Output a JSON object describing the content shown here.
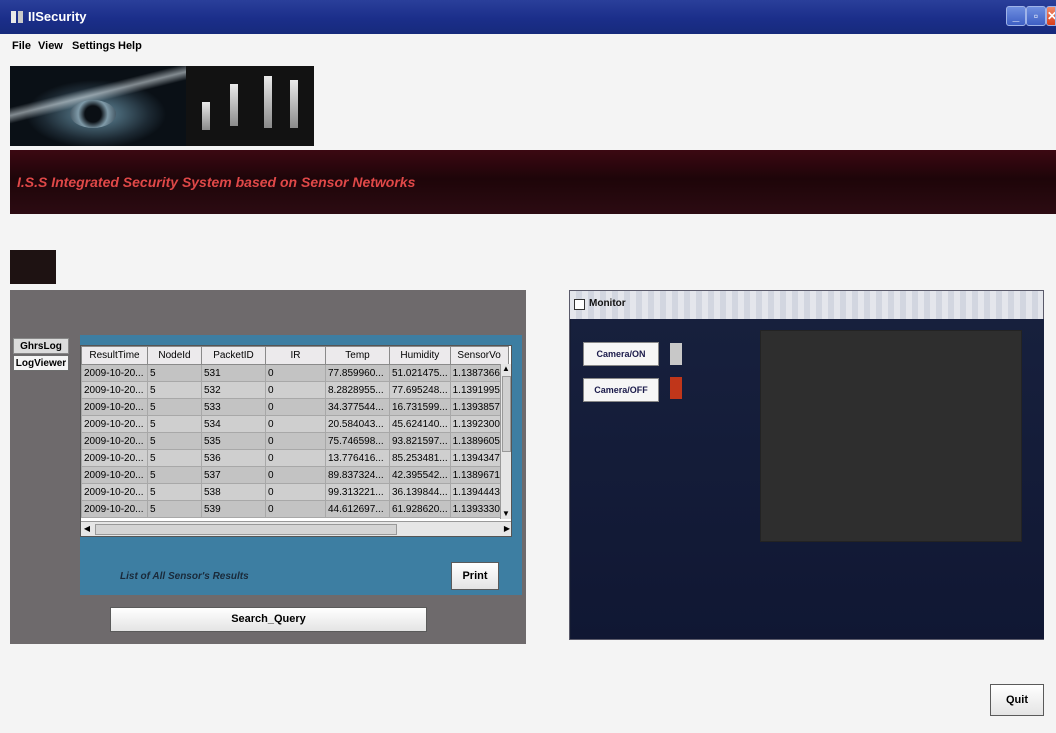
{
  "window": {
    "title": "IISecurity"
  },
  "menu": [
    "File",
    "View",
    "Settings",
    "Help"
  ],
  "header": {
    "text": "I.S.S    Integrated Security System based on Sensor Networks"
  },
  "red_tab": {
    "label": ""
  },
  "side_tabs": [
    "GhrsLog",
    "LogViewer"
  ],
  "table": {
    "columns": [
      "ResultTime",
      "NodeId",
      "PacketID",
      "IR",
      "Temp",
      "Humidity",
      "SensorVo"
    ],
    "rows": [
      [
        "2009-10-20...",
        "5",
        "531",
        "0",
        "77.859960...",
        "51.021475...",
        "1.1387366"
      ],
      [
        "2009-10-20...",
        "5",
        "532",
        "0",
        "8.2828955...",
        "77.695248...",
        "1.1391995"
      ],
      [
        "2009-10-20...",
        "5",
        "533",
        "0",
        "34.377544...",
        "16.731599...",
        "1.1393857"
      ],
      [
        "2009-10-20...",
        "5",
        "534",
        "0",
        "20.584043...",
        "45.624140...",
        "1.1392300"
      ],
      [
        "2009-10-20...",
        "5",
        "535",
        "0",
        "75.746598...",
        "93.821597...",
        "1.1389605"
      ],
      [
        "2009-10-20...",
        "5",
        "536",
        "0",
        "13.776416...",
        "85.253481...",
        "1.1394347"
      ],
      [
        "2009-10-20...",
        "5",
        "537",
        "0",
        "89.837324...",
        "42.395542...",
        "1.1389671"
      ],
      [
        "2009-10-20...",
        "5",
        "538",
        "0",
        "99.313221...",
        "36.139844...",
        "1.1394443"
      ],
      [
        "2009-10-20...",
        "5",
        "539",
        "0",
        "44.612697...",
        "61.928620...",
        "1.1393330"
      ]
    ]
  },
  "results_caption": "List of All Sensor's Results",
  "buttons": {
    "print": "Print",
    "search": "Search_Query",
    "quit": "Quit"
  },
  "monitor": {
    "title": "Monitor",
    "camera_on": "Camera/ON",
    "camera_off": "Camera/OFF"
  },
  "colors": {
    "titlebar": "#1b2e8a",
    "header_bg": "#2c0b12",
    "header_text": "#e04848",
    "teal_panel": "#3d7ea2",
    "monitor_bg": "#141b33",
    "camera_off_indicator": "#c0361a",
    "camera_on_indicator": "#c8c8c8"
  },
  "icons": [
    "app-icon",
    "minimize-icon",
    "maximize-icon",
    "close-icon",
    "window-icon",
    "scroll-up-icon",
    "scroll-down-icon",
    "scroll-left-icon",
    "scroll-right-icon"
  ]
}
